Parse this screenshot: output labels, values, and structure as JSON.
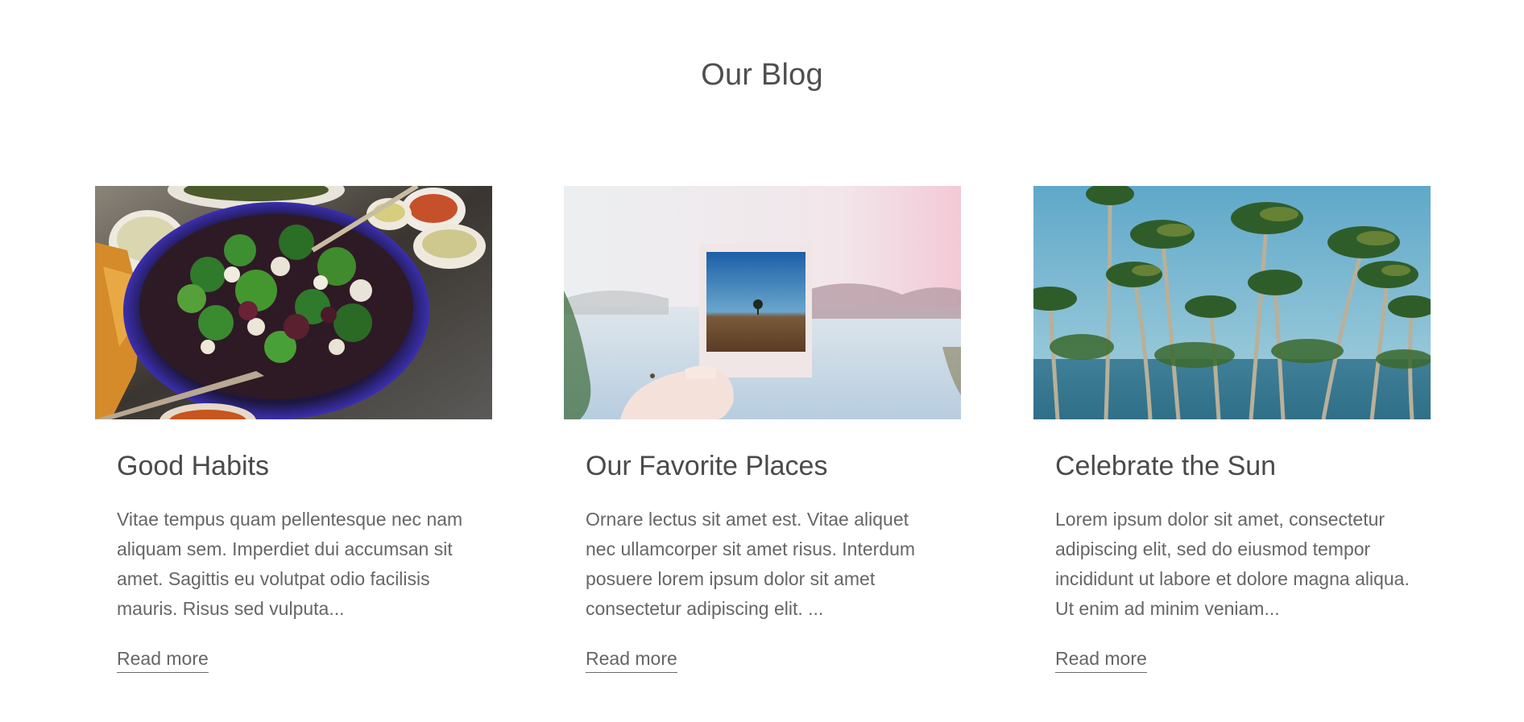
{
  "section": {
    "title": "Our Blog"
  },
  "posts": [
    {
      "title": "Good Habits",
      "excerpt": "Vitae tempus quam pellentesque nec nam aliquam sem. Imperdiet dui accumsan sit amet. Sagittis eu volutpat odio facilisis mauris. Risus sed vulputa...",
      "link_label": "Read more",
      "image_subject": "salad-bowl-photo"
    },
    {
      "title": "Our Favorite Places",
      "excerpt": "Ornare lectus sit amet est. Vitae aliquet nec ullamcorper sit amet risus. Interdum posuere lorem ipsum dolor sit amet consectetur adipiscing elit. ...",
      "link_label": "Read more",
      "image_subject": "polaroid-photo"
    },
    {
      "title": "Celebrate the Sun",
      "excerpt": "Lorem ipsum dolor sit amet, consectetur adipiscing elit, sed do eiusmod tempor incididunt ut labore et dolore magna aliqua. Ut enim ad minim veniam...",
      "link_label": "Read more",
      "image_subject": "palm-trees-photo"
    }
  ],
  "colors": {
    "text": "#555555",
    "heading": "#4a4a4a",
    "background": "#ffffff"
  }
}
